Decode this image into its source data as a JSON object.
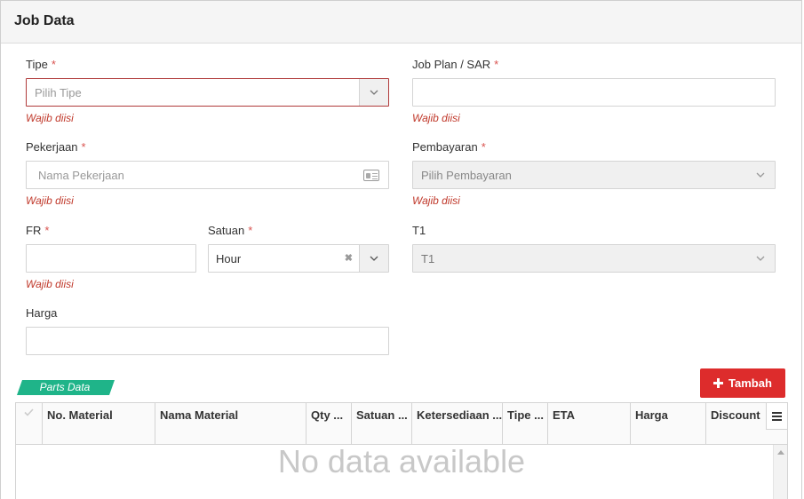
{
  "header": {
    "title": "Job Data"
  },
  "fields": {
    "tipe": {
      "label": "Tipe",
      "required": "*",
      "placeholder": "Pilih Tipe",
      "error": "Wajib diisi"
    },
    "job_plan": {
      "label": "Job Plan / SAR",
      "required": "*",
      "error": "Wajib diisi"
    },
    "pekerjaan": {
      "label": "Pekerjaan",
      "required": "*",
      "placeholder": "Nama Pekerjaan",
      "error": "Wajib diisi"
    },
    "pembayaran": {
      "label": "Pembayaran",
      "required": "*",
      "placeholder": "Pilih Pembayaran",
      "error": "Wajib diisi"
    },
    "fr": {
      "label": "FR",
      "required": "*",
      "error": "Wajib diisi"
    },
    "satuan": {
      "label": "Satuan",
      "required": "*",
      "value": "Hour",
      "clear": "✖"
    },
    "t1": {
      "label": "T1",
      "value": "T1"
    },
    "harga": {
      "label": "Harga"
    }
  },
  "parts": {
    "section_label": "Parts Data",
    "add_button": {
      "icon": "plus-icon",
      "label": "Tambah"
    },
    "columns": [
      "No. Material",
      "Nama Material",
      "Qty ...",
      "Satuan ...",
      "Ketersediaan ...",
      "Tipe ...",
      "ETA",
      "Harga",
      "Discount"
    ],
    "empty_text": "No data available"
  },
  "colors": {
    "accent_green": "#1fb489",
    "danger": "#dd2c2c",
    "error_text": "#c0392b"
  }
}
